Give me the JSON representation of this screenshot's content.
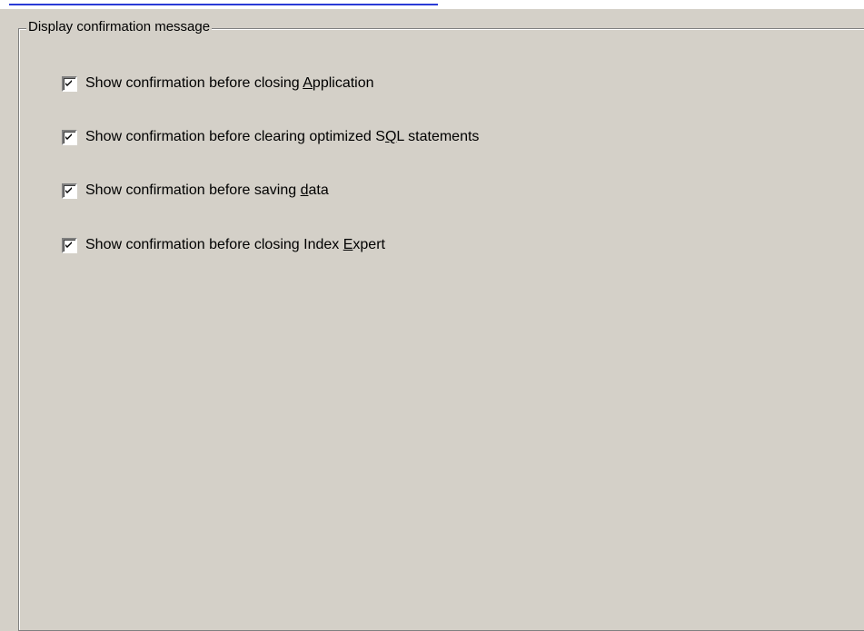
{
  "groupbox": {
    "title": "Display confirmation message"
  },
  "options": [
    {
      "before": "Show confirmation before closing ",
      "mnemonic": "A",
      "after": "pplication",
      "checked": true
    },
    {
      "before": "Show confirmation before clearing optimized S",
      "mnemonic": "Q",
      "after": "L statements",
      "checked": true
    },
    {
      "before": "Show confirmation before saving ",
      "mnemonic": "d",
      "after": "ata",
      "checked": true
    },
    {
      "before": "Show confirmation before closing Index ",
      "mnemonic": "E",
      "after": "xpert",
      "checked": true
    }
  ],
  "colors": {
    "panel": "#d4d0c8",
    "link": "#2a3bd6",
    "checkmark": "#000000"
  }
}
